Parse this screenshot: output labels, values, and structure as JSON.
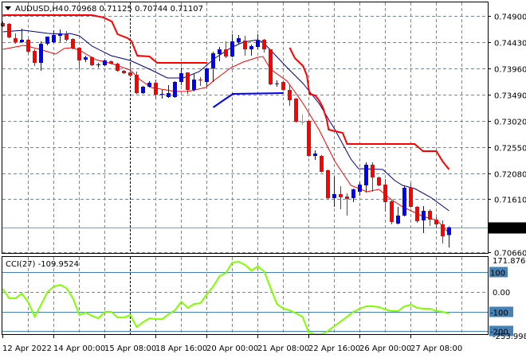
{
  "header": {
    "symbol": "AUDUSD,H4",
    "ohlc": "0.70968 0.71125 0.70744 0.71107",
    "menu_icon": "triangle-down-icon"
  },
  "colors": {
    "bull": "#0000ff",
    "bear": "#ff0000",
    "doji_green": "#00ff00",
    "ma_fast": "#ff0000",
    "ma_slow": "#000080",
    "cci": "#7fff00",
    "level": "#4682b4",
    "grid": "#778899"
  },
  "price_axis": {
    "labels": [
      "0.74900",
      "0.74430",
      "0.73960",
      "0.73490",
      "0.73020",
      "0.72550",
      "0.72080",
      "0.71610",
      "0.70660"
    ],
    "last_price": "0.71107"
  },
  "cci": {
    "title": "CCI(27) -109.9524",
    "axis_labels": {
      "max": "171.8765",
      "zero": "0.00",
      "min": "-253.9982"
    },
    "levels": [
      "100",
      "-100",
      "-200"
    ],
    "values": [
      16,
      -32,
      -32,
      -8,
      -53,
      -126,
      -65,
      0,
      28,
      36,
      20,
      -32,
      -117,
      -105,
      -122,
      -134,
      -101,
      -101,
      -130,
      -130,
      -117,
      -178,
      -154,
      -134,
      -138,
      -138,
      -113,
      -93,
      -49,
      -81,
      -61,
      -57,
      -12,
      28,
      81,
      97,
      150,
      154,
      138,
      109,
      130,
      105,
      20,
      -61,
      -85,
      -93,
      -109,
      -126,
      -207,
      -215,
      -215,
      -198,
      -174,
      -150,
      -126,
      -101,
      -85,
      -73,
      -73,
      -77,
      -89,
      -97,
      -97,
      -73,
      -65,
      -81,
      -85,
      -85,
      -97,
      -101,
      -109.9524
    ]
  },
  "time_axis": {
    "labels": [
      "12 Apr 2022",
      "14 Apr 00:00",
      "15 Apr 08:00",
      "18 Apr 16:00",
      "20 Apr 00:00",
      "21 Apr 08:00",
      "22 Apr 16:00",
      "26 Apr 00:00",
      "27 Apr 08:00"
    ]
  },
  "chart_data": {
    "type": "candlestick",
    "symbol": "AUDUSD",
    "timeframe": "H4",
    "ylim": [
      0.7066,
      0.749
    ],
    "candles_ohlc": [
      [
        0.74772,
        0.748,
        0.747,
        0.74714
      ],
      [
        0.74757,
        0.74772,
        0.745,
        0.74515
      ],
      [
        0.745,
        0.74586,
        0.744,
        0.74429
      ],
      [
        0.74429,
        0.74672,
        0.74415,
        0.74472
      ],
      [
        0.74472,
        0.74486,
        0.74229,
        0.74258
      ],
      [
        0.74272,
        0.743,
        0.74001,
        0.74058
      ],
      [
        0.74058,
        0.74443,
        0.73915,
        0.744
      ],
      [
        0.744,
        0.74529,
        0.74372,
        0.74529
      ],
      [
        0.74429,
        0.74643,
        0.74415,
        0.74557
      ],
      [
        0.74543,
        0.74657,
        0.74429,
        0.74586
      ],
      [
        0.74572,
        0.74629,
        0.74443,
        0.74472
      ],
      [
        0.74486,
        0.745,
        0.743,
        0.74315
      ],
      [
        0.74329,
        0.74329,
        0.73944,
        0.74101
      ],
      [
        0.74115,
        0.74186,
        0.74072,
        0.74158
      ],
      [
        0.74158,
        0.74172,
        0.74001,
        0.74015
      ],
      [
        0.74029,
        0.74058,
        0.73972,
        0.74029
      ],
      [
        0.74015,
        0.74115,
        0.74001,
        0.74101
      ],
      [
        0.74086,
        0.74101,
        0.74029,
        0.74043
      ],
      [
        0.74043,
        0.74058,
        0.73901,
        0.73915
      ],
      [
        0.73915,
        0.73929,
        0.73858,
        0.73872
      ],
      [
        0.73886,
        0.74029,
        0.73801,
        0.73829
      ],
      [
        0.73844,
        0.73901,
        0.73501,
        0.73515
      ],
      [
        0.73515,
        0.73644,
        0.73501,
        0.73629
      ],
      [
        0.73629,
        0.73729,
        0.73615,
        0.73701
      ],
      [
        0.73701,
        0.73758,
        0.73415,
        0.73487
      ],
      [
        0.73501,
        0.73572,
        0.73415,
        0.73501
      ],
      [
        0.73444,
        0.73658,
        0.7343,
        0.73515
      ],
      [
        0.73444,
        0.73729,
        0.7343,
        0.73715
      ],
      [
        0.73715,
        0.73972,
        0.73658,
        0.73872
      ],
      [
        0.73886,
        0.73886,
        0.73501,
        0.73572
      ],
      [
        0.73572,
        0.73858,
        0.73544,
        0.73758
      ],
      [
        0.73758,
        0.73801,
        0.73644,
        0.73744
      ],
      [
        0.73715,
        0.73972,
        0.73644,
        0.73958
      ],
      [
        0.73958,
        0.74258,
        0.73715,
        0.74229
      ],
      [
        0.74215,
        0.74343,
        0.74086,
        0.743
      ],
      [
        0.743,
        0.74443,
        0.74143,
        0.74172
      ],
      [
        0.74172,
        0.74572,
        0.74158,
        0.74443
      ],
      [
        0.74429,
        0.74557,
        0.744,
        0.745
      ],
      [
        0.74457,
        0.74543,
        0.74186,
        0.743
      ],
      [
        0.743,
        0.74386,
        0.74186,
        0.74358
      ],
      [
        0.74343,
        0.74572,
        0.743,
        0.74457
      ],
      [
        0.74472,
        0.74486,
        0.74243,
        0.743
      ],
      [
        0.743,
        0.743,
        0.73658,
        0.73672
      ],
      [
        0.73687,
        0.73744,
        0.73629,
        0.7369
      ],
      [
        0.73715,
        0.73729,
        0.73558,
        0.73572
      ],
      [
        0.73572,
        0.73658,
        0.73287,
        0.73387
      ],
      [
        0.73415,
        0.7343,
        0.72987,
        0.73001
      ],
      [
        0.73001,
        0.7313,
        0.72944,
        0.73001
      ],
      [
        0.73016,
        0.7303,
        0.72373,
        0.72387
      ],
      [
        0.72387,
        0.72487,
        0.72316,
        0.7243
      ],
      [
        0.72387,
        0.72402,
        0.72088,
        0.72102
      ],
      [
        0.7213,
        0.72145,
        0.71617,
        0.71631
      ],
      [
        0.71631,
        0.72016,
        0.71474,
        0.71702
      ],
      [
        0.71702,
        0.71845,
        0.71431,
        0.71645
      ],
      [
        0.71659,
        0.71716,
        0.71317,
        0.71617
      ],
      [
        0.71631,
        0.71802,
        0.71559,
        0.71788
      ],
      [
        0.71745,
        0.71916,
        0.71673,
        0.71873
      ],
      [
        0.71859,
        0.72273,
        0.71731,
        0.7223
      ],
      [
        0.7223,
        0.72273,
        0.71745,
        0.72002
      ],
      [
        0.72002,
        0.72016,
        0.71845,
        0.71859
      ],
      [
        0.71873,
        0.71973,
        0.71388,
        0.71559
      ],
      [
        0.71574,
        0.71588,
        0.7116,
        0.71202
      ],
      [
        0.71174,
        0.71474,
        0.7116,
        0.71317
      ],
      [
        0.71317,
        0.71845,
        0.71302,
        0.71816
      ],
      [
        0.71816,
        0.71902,
        0.71459,
        0.71474
      ],
      [
        0.71474,
        0.71488,
        0.71188,
        0.71217
      ],
      [
        0.71231,
        0.71488,
        0.71003,
        0.71402
      ],
      [
        0.71402,
        0.71431,
        0.71131,
        0.71245
      ],
      [
        0.71245,
        0.71288,
        0.71088,
        0.7116
      ],
      [
        0.7116,
        0.71231,
        0.70817,
        0.70946
      ],
      [
        0.70968,
        0.71125,
        0.70744,
        0.71107
      ]
    ],
    "doji_green_index": 47,
    "ma_slow": [
      [
        0,
        0.74614
      ],
      [
        3.3,
        0.74643
      ],
      [
        7.1,
        0.74586
      ],
      [
        9.6,
        0.74572
      ],
      [
        10.5,
        0.74586
      ],
      [
        12,
        0.74543
      ],
      [
        14,
        0.74358
      ],
      [
        17,
        0.74186
      ],
      [
        20,
        0.74101
      ],
      [
        23.3,
        0.73929
      ],
      [
        25.8,
        0.73787
      ],
      [
        28.3,
        0.73787
      ],
      [
        30.8,
        0.73901
      ],
      [
        33.3,
        0.74143
      ],
      [
        35.8,
        0.74329
      ],
      [
        37.7,
        0.74429
      ],
      [
        40,
        0.74472
      ],
      [
        40.8,
        0.74429
      ],
      [
        42,
        0.74286
      ],
      [
        44.6,
        0.73972
      ],
      [
        47.1,
        0.73687
      ],
      [
        49.6,
        0.7333
      ],
      [
        52.1,
        0.72859
      ],
      [
        54.6,
        0.7233
      ],
      [
        55.8,
        0.72159
      ],
      [
        59.6,
        0.72145
      ],
      [
        61.5,
        0.71945
      ],
      [
        62.7,
        0.71859
      ],
      [
        64.6,
        0.71802
      ],
      [
        67.1,
        0.71645
      ],
      [
        70,
        0.71402
      ]
    ],
    "ma_fast": [
      [
        0,
        0.743
      ],
      [
        3.3,
        0.74372
      ],
      [
        5.8,
        0.743
      ],
      [
        8.3,
        0.74215
      ],
      [
        9.6,
        0.74315
      ],
      [
        10.8,
        0.74329
      ],
      [
        12,
        0.74286
      ],
      [
        14.6,
        0.74115
      ],
      [
        17.1,
        0.74043
      ],
      [
        20,
        0.73929
      ],
      [
        21.5,
        0.73758
      ],
      [
        23.3,
        0.73615
      ],
      [
        27.1,
        0.73544
      ],
      [
        29,
        0.73544
      ],
      [
        31.8,
        0.73615
      ],
      [
        33.3,
        0.73758
      ],
      [
        35.8,
        0.73972
      ],
      [
        37.7,
        0.74072
      ],
      [
        40,
        0.74158
      ],
      [
        40.8,
        0.74172
      ],
      [
        42,
        0.73944
      ],
      [
        44.6,
        0.73729
      ],
      [
        47.1,
        0.7333
      ],
      [
        49.6,
        0.72859
      ],
      [
        52.1,
        0.72287
      ],
      [
        54.6,
        0.71859
      ],
      [
        57.1,
        0.71745
      ],
      [
        59,
        0.71788
      ],
      [
        60.8,
        0.71617
      ],
      [
        62.7,
        0.71474
      ],
      [
        65.9,
        0.71302
      ],
      [
        68.1,
        0.71231
      ],
      [
        70,
        0.71003
      ]
    ],
    "stop_upper": [
      [
        [
          0,
          0.74914
        ],
        [
          14,
          0.74914
        ],
        [
          15.8,
          0.74871
        ],
        [
          17.1,
          0.748
        ],
        [
          18,
          0.74572
        ],
        [
          19.6,
          0.745
        ],
        [
          20.2,
          0.74443
        ],
        [
          21.1,
          0.74186
        ],
        [
          23,
          0.74172
        ],
        [
          24.2,
          0.74058
        ],
        [
          32.1,
          0.74058
        ]
      ],
      [
        [
          45,
          0.74329
        ],
        [
          45.8,
          0.74143
        ],
        [
          47.1,
          0.74001
        ],
        [
          47.7,
          0.73829
        ],
        [
          48.1,
          0.73501
        ],
        [
          49,
          0.73472
        ],
        [
          49.6,
          0.73387
        ],
        [
          50.2,
          0.73258
        ],
        [
          50.8,
          0.73044
        ],
        [
          51.1,
          0.72859
        ],
        [
          53.3,
          0.72801
        ],
        [
          54,
          0.72602
        ],
        [
          64.6,
          0.72602
        ],
        [
          65.9,
          0.72473
        ],
        [
          68,
          0.72473
        ],
        [
          69,
          0.72287
        ],
        [
          70,
          0.72145
        ]
      ]
    ],
    "stop_lower": [
      [
        33,
        0.73258
      ],
      [
        34.8,
        0.73401
      ],
      [
        36.1,
        0.73501
      ],
      [
        44,
        0.73515
      ]
    ]
  }
}
